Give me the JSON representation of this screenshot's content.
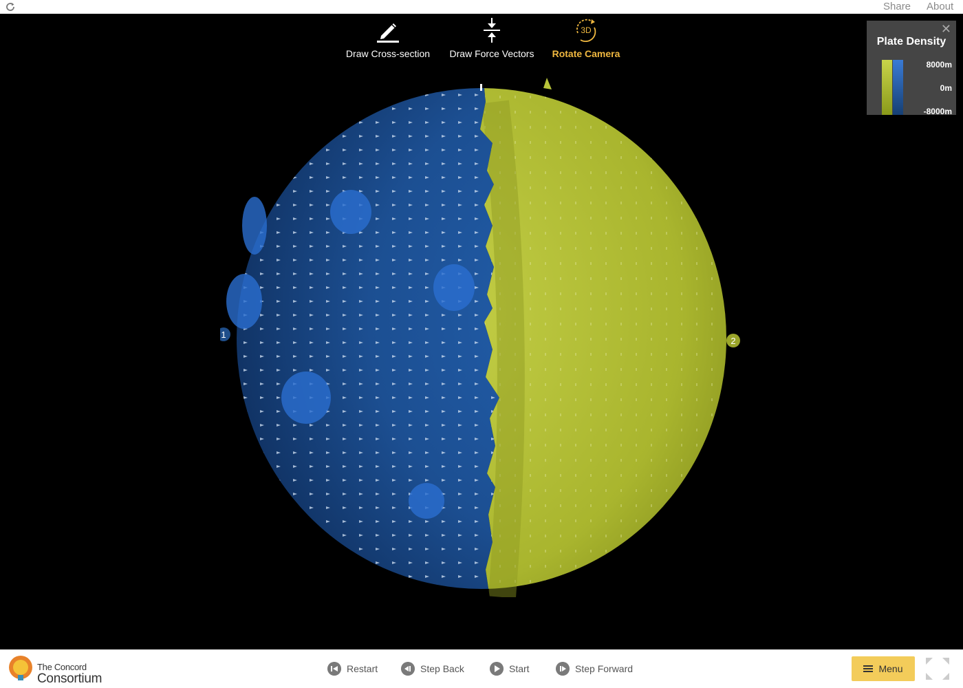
{
  "topbar": {
    "share_label": "Share",
    "about_label": "About"
  },
  "tools": {
    "draw_label": "Draw Cross-section",
    "force_label": "Draw Force Vectors",
    "rotate_label": "Rotate Camera",
    "rotate_icon_text": "3D",
    "active": "rotate-camera"
  },
  "globe": {
    "north_label": "N",
    "plate_1_label": "1",
    "plate_2_label": "2",
    "plate_1_color": "#1f4e8a",
    "plate_2_color": "#b8c43a"
  },
  "legend": {
    "title": "Plate Density",
    "max_label": "8000m",
    "mid_label": "0m",
    "min_label": "-8000m",
    "close_icon": "close-icon"
  },
  "bottombar": {
    "logo_line1": "The Concord",
    "logo_line2": "Consortium",
    "restart_label": "Restart",
    "stepback_label": "Step Back",
    "start_label": "Start",
    "stepforward_label": "Step Forward",
    "menu_label": "Menu"
  }
}
